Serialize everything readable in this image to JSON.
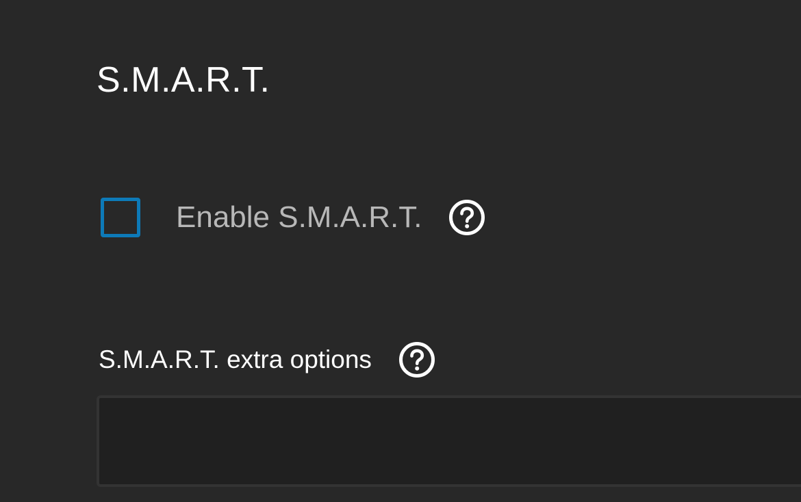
{
  "section": {
    "title": "S.M.A.R.T."
  },
  "smart_toggle": {
    "label": "Enable S.M.A.R.T.",
    "checked": false,
    "help_icon": "help-circle-icon",
    "accent_color": "#0d7ab8"
  },
  "extra_options": {
    "label": "S.M.A.R.T. extra options",
    "value": "",
    "placeholder": "",
    "help_icon": "help-circle-icon"
  },
  "colors": {
    "background": "#282828",
    "input_background": "#202020",
    "label_muted": "#b8b8b8",
    "text_primary": "#ffffff"
  }
}
